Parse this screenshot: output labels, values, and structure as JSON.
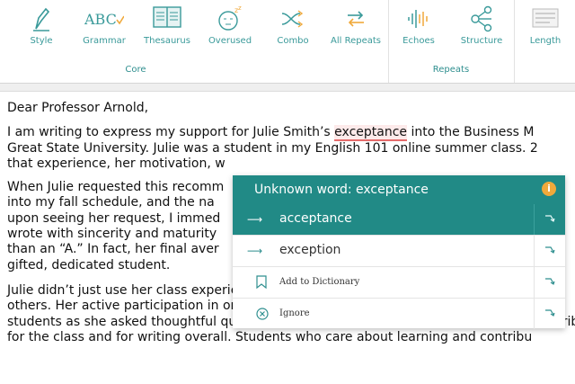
{
  "toolbar": {
    "items": [
      {
        "label": "Style",
        "icon": "pencil-icon"
      },
      {
        "label": "Grammar",
        "icon": "abc-check-icon"
      },
      {
        "label": "Thesaurus",
        "icon": "book-icon"
      },
      {
        "label": "Overused",
        "icon": "sleepy-face-icon"
      },
      {
        "label": "Combo",
        "icon": "shuffle-icon"
      },
      {
        "label": "All Repeats",
        "icon": "repeat-icon"
      },
      {
        "label": "Echoes",
        "icon": "soundwave-icon"
      },
      {
        "label": "Structure",
        "icon": "structure-icon"
      },
      {
        "label": "Length",
        "icon": "ruler-icon"
      }
    ],
    "groups": {
      "core": "Core",
      "repeats": "Repeats"
    }
  },
  "document": {
    "salutation": "Dear Professor Arnold,",
    "p1": {
      "line1_before": "I am writing to express my support for Julie Smith’s ",
      "misspelled": "exceptance",
      "line1_after": " into the Business M",
      "line2": "Great State University. Julie was a student in my English 101 online summer class. 2",
      "line3": "that experience, her motivation, w"
    },
    "p2": [
      "When Julie requested this recomm",
      "into my fall schedule, and the na",
      "upon seeing her request, I immed",
      "wrote with sincerity and maturity",
      "than an “A.” In fact, her final aver",
      "gifted, dedicated student."
    ],
    "p3": [
      "Julie didn’t just use her class experience to improve her own skills; she enriched the",
      "others. Her active participation in online discussions facilitated greater participation",
      "students as she asked thoughtful questions, offered insightful responses, and gave contribu",
      "for the class and for writing overall. Students who care about learning and contribu"
    ]
  },
  "popup": {
    "title": "Unknown word: exceptance",
    "info": "i",
    "suggestions": [
      {
        "arrow": "⟶",
        "word": "acceptance"
      },
      {
        "arrow": "⟶",
        "word": "exception"
      }
    ],
    "add_dictionary": "Add to Dictionary",
    "ignore": "Ignore"
  }
}
